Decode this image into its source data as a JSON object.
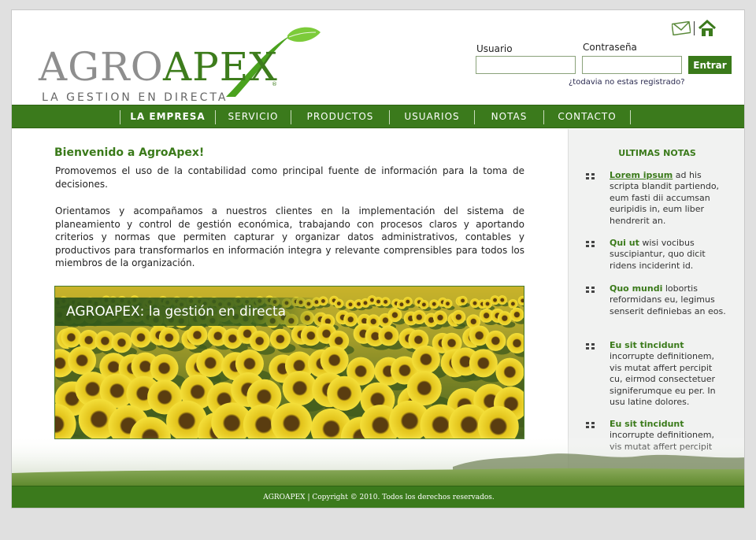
{
  "logo": {
    "brand_part1": "AGRO",
    "brand_part2": "APEX",
    "registered": "®",
    "tagline": "LA GESTION EN DIRECTA",
    "leaf_color": "#6fbf2e"
  },
  "header_icons": {
    "mail_icon": "mail-icon",
    "home_icon": "home-icon"
  },
  "login": {
    "user_label": "Usuario",
    "user_value": "",
    "password_label": "Contraseña",
    "password_value": "",
    "submit_label": "Entrar",
    "register_link": "¿todavia no estas registrado?"
  },
  "nav": {
    "items": [
      {
        "label": "LA EMPRESA",
        "active": true
      },
      {
        "label": "SERVICIO",
        "active": false
      },
      {
        "label": "PRODUCTOS",
        "active": false
      },
      {
        "label": "USUARIOS",
        "active": false
      },
      {
        "label": "NOTAS",
        "active": false
      },
      {
        "label": "CONTACTO",
        "active": false
      }
    ]
  },
  "main": {
    "welcome_title": "Bienvenido a AgroApex!",
    "paragraph1": "Promovemos el uso de la contabilidad como principal fuente de información para la toma de decisiones.",
    "paragraph2": "Orientamos y acompañamos a nuestros clientes en la implementación del sistema de planeamiento y control de gestión económica, trabajando con procesos claros y aportando criterios y normas que permiten capturar y organizar datos administrativos, contables y productivos para transformarlos en información integra y relevante comprensibles para todos los miembros de la organización.",
    "banner_caption": "AGROAPEX: la gestión en directa"
  },
  "sidebar": {
    "title": "ULTIMAS NOTAS",
    "notes": [
      {
        "title": "Lorem ipsum",
        "text": " ad his scripta blandit partiendo, eum fasti dii accumsan euripidis in, eum liber hendrerit an."
      },
      {
        "title": "Qui ut",
        "text": " wisi vocibus suscipiantur, quo dicit ridens inciderint id."
      },
      {
        "title": "Quo mundi",
        "text": " lobortis reformidans eu, legimus senserit definiebas an eos."
      },
      {
        "title": "Eu sit tincidunt",
        "text": " incorrupte definitionem, vis mutat affert percipit cu, eirmod consectetuer signiferumque eu per. In usu latine dolores."
      },
      {
        "title": "Eu sit tincidunt",
        "text": " incorrupte definitionem, vis mutat affert percipit"
      }
    ]
  },
  "footer": {
    "text": "AGROAPEX | Copyright © 2010. Todos los derechos reservados."
  },
  "colors": {
    "brand_green": "#3b7a1c",
    "logo_grey": "#8e8e8e",
    "sidebar_bg": "#f1f2f1"
  }
}
